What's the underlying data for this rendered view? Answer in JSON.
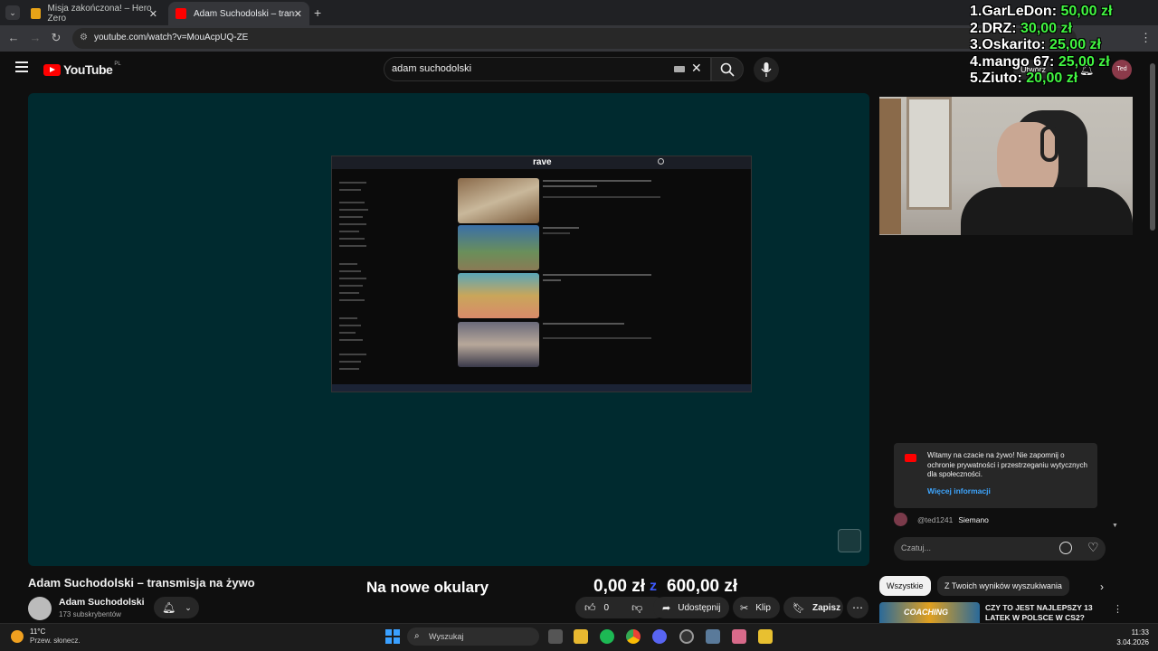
{
  "browser": {
    "tabs": [
      {
        "label": "Misja zakończona! – Hero Zero",
        "active": false
      },
      {
        "label": "Adam Suchodolski – transmisja",
        "active": true
      }
    ],
    "url": "youtube.com/watch?v=MouAcpUQ-ZE"
  },
  "yt": {
    "logo": "YouTube",
    "region": "PL",
    "search_value": "adam suchodolski",
    "avatar_text": "Ted",
    "create_label": "Utwórz"
  },
  "donations": [
    {
      "rank": "1.",
      "name": "GarLeDon:",
      "amount": "50,00 zł"
    },
    {
      "rank": "2.",
      "name": "DRZ:",
      "amount": "30,00 zł"
    },
    {
      "rank": "3.",
      "name": "Oskarito:",
      "amount": "25,00 zł"
    },
    {
      "rank": "4.",
      "name": "mango 67:",
      "amount": "25,00 zł"
    },
    {
      "rank": "5.",
      "name": "Ziuto:",
      "amount": "20,00 zł"
    }
  ],
  "inner_screen": {
    "logo": "rave"
  },
  "chat": {
    "notice": "Witamy na czacie na żywo! Nie zapomnij o ochronie prywatności i przestrzeganiu wytycznych dla społeczności.",
    "notice_link": "Więcej informacji",
    "message_user": "@ted1241",
    "message_text": "Siemano",
    "input_placeholder": "Czatuj..."
  },
  "video": {
    "title": "Adam Suchodolski – transmisja na żywo",
    "channel": "Adam Suchodolski",
    "subscribers": "173 subskrybentów",
    "likes": "0",
    "share": "Udostępnij",
    "clip": "Klip",
    "save": "Zapisz"
  },
  "goal": {
    "label": "Na nowe okulary",
    "current": "0,00 zł",
    "sep": "z",
    "target": "600,00 zł"
  },
  "recommendations": {
    "chips": [
      "Wszystkie",
      "Z Twoich wyników wyszukiwania"
    ],
    "first_title": "CZY TO JEST NAJLEPSZY 13 LATEK W POLSCE W CS2?",
    "first_thumb_text": "COACHING"
  },
  "taskbar": {
    "weather_temp": "11°C",
    "weather_desc": "Przew. słonecz.",
    "search_placeholder": "Wyszukaj",
    "time": "11:33",
    "date": "3.04.2026"
  },
  "colors": {
    "accent_red": "#ff0000",
    "donation_green": "#42f542",
    "goal_blue": "#3d5afe",
    "player_bg": "#002a2f"
  }
}
